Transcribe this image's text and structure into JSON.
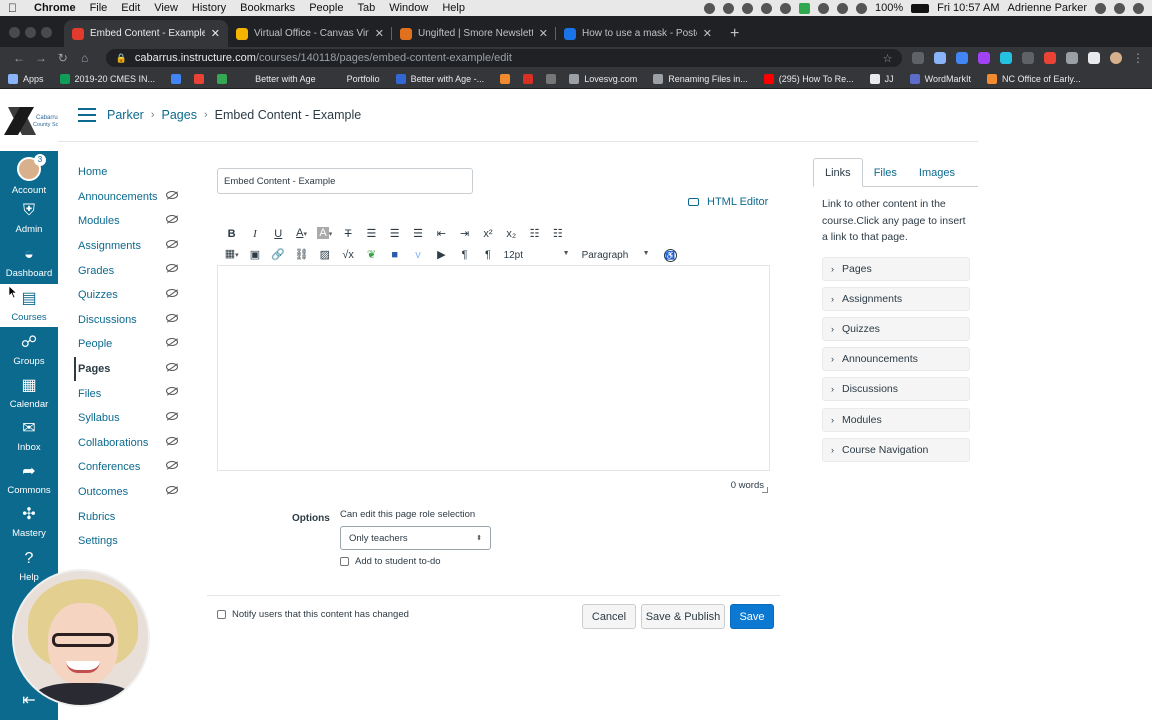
{
  "menubar": {
    "app": "Chrome",
    "items": [
      "File",
      "Edit",
      "View",
      "History",
      "Bookmarks",
      "People",
      "Tab",
      "Window",
      "Help"
    ],
    "battery": "100%",
    "clock": "Fri 10:57 AM",
    "user": "Adrienne Parker"
  },
  "tabs": [
    {
      "title": "Embed Content - Example: Pa",
      "color": "#e23b2e",
      "active": true
    },
    {
      "title": "Virtual Office - Canvas Virtual",
      "color": "#f4b400",
      "active": false
    },
    {
      "title": "Ungifted | Smore Newsletters",
      "color": "#e2711d",
      "active": false
    },
    {
      "title": "How to use a mask - Poster (U",
      "color": "#1a73e8",
      "active": false
    }
  ],
  "address": {
    "host": "cabarrus.instructure.com",
    "path": "/courses/140118/pages/embed-content-example/edit"
  },
  "bookmarks": [
    {
      "label": "Apps",
      "color": "#8ab4f8"
    },
    {
      "label": "2019-20 CMES IN...",
      "color": "#0f9d58"
    },
    {
      "label": "",
      "color": "#4285f4"
    },
    {
      "label": "",
      "color": "#ea4335"
    },
    {
      "label": "",
      "color": "#34a853"
    },
    {
      "label": "Better with Age",
      "color": "#35363a"
    },
    {
      "label": "Portfolio",
      "color": "#35363a"
    },
    {
      "label": "Better with Age -...",
      "color": "#3367d6"
    },
    {
      "label": "",
      "color": "#f28b30"
    },
    {
      "label": "",
      "color": "#d93025"
    },
    {
      "label": "",
      "color": "#777777"
    },
    {
      "label": "Lovesvg.com",
      "color": "#9aa0a6"
    },
    {
      "label": "Renaming Files in...",
      "color": "#9aa0a6"
    },
    {
      "label": "(295) How To Re...",
      "color": "#ff0000"
    },
    {
      "label": "JJ",
      "color": "#e8eaed"
    },
    {
      "label": "WordMarkIt",
      "color": "#5b6cc9"
    },
    {
      "label": "NC Office of Early...",
      "color": "#f28b30"
    }
  ],
  "global_nav": {
    "account_badge": "3",
    "items": [
      {
        "label": "Account",
        "icon": "avatar-icon"
      },
      {
        "label": "Admin",
        "icon": "shield-icon"
      },
      {
        "label": "Dashboard",
        "icon": "dashboard-icon"
      },
      {
        "label": "Courses",
        "icon": "book-icon"
      },
      {
        "label": "Groups",
        "icon": "groups-icon"
      },
      {
        "label": "Calendar",
        "icon": "calendar-icon"
      },
      {
        "label": "Inbox",
        "icon": "inbox-icon"
      },
      {
        "label": "Commons",
        "icon": "commons-icon"
      },
      {
        "label": "Mastery",
        "icon": "mastery-icon"
      },
      {
        "label": "Help",
        "icon": "help-icon"
      }
    ],
    "brand_color": "#0d6a8f"
  },
  "breadcrumb": {
    "course": "Parker",
    "section": "Pages",
    "current": "Embed Content - Example"
  },
  "course_nav": [
    {
      "label": "Home",
      "hidden": false,
      "active": false
    },
    {
      "label": "Announcements",
      "hidden": true,
      "active": false
    },
    {
      "label": "Modules",
      "hidden": true,
      "active": false
    },
    {
      "label": "Assignments",
      "hidden": true,
      "active": false
    },
    {
      "label": "Grades",
      "hidden": true,
      "active": false
    },
    {
      "label": "Quizzes",
      "hidden": true,
      "active": false
    },
    {
      "label": "Discussions",
      "hidden": true,
      "active": false
    },
    {
      "label": "People",
      "hidden": true,
      "active": false
    },
    {
      "label": "Pages",
      "hidden": true,
      "active": true
    },
    {
      "label": "Files",
      "hidden": true,
      "active": false
    },
    {
      "label": "Syllabus",
      "hidden": true,
      "active": false
    },
    {
      "label": "Collaborations",
      "hidden": true,
      "active": false
    },
    {
      "label": "Conferences",
      "hidden": true,
      "active": false
    },
    {
      "label": "Outcomes",
      "hidden": true,
      "active": false
    },
    {
      "label": "Rubrics",
      "hidden": false,
      "active": false
    },
    {
      "label": "Settings",
      "hidden": false,
      "active": false
    }
  ],
  "editor": {
    "title_value": "Embed Content - Example",
    "html_editor_label": "HTML Editor",
    "font_size": "12pt",
    "block_format": "Paragraph",
    "word_count": "0 words",
    "options_label": "Options",
    "edit_role_label": "Can edit this page role selection",
    "edit_role_value": "Only teachers",
    "todo_label": "Add to student to-do",
    "notify_label": "Notify users that this content has changed",
    "cancel_label": "Cancel",
    "save_publish_label": "Save & Publish",
    "save_label": "Save"
  },
  "sidebar": {
    "tabs": [
      "Links",
      "Files",
      "Images"
    ],
    "description": "Link to other content in the course.Click any page to insert a link to that page.",
    "sections": [
      "Pages",
      "Assignments",
      "Quizzes",
      "Announcements",
      "Discussions",
      "Modules",
      "Course Navigation"
    ]
  }
}
